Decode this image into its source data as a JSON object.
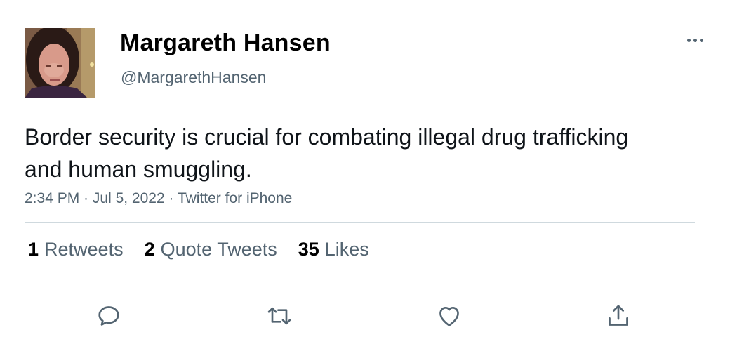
{
  "author": {
    "display_name": "Margareth Hansen",
    "handle": "@MargarethHansen"
  },
  "tweet": {
    "text": "Border security is crucial for combating illegal drug trafficking and human smuggling.",
    "time": "2:34 PM",
    "separator": " · ",
    "date": "Jul 5, 2022",
    "source": "Twitter for iPhone"
  },
  "stats": {
    "retweets_count": "1",
    "retweets_label": "Retweets",
    "quotes_count": "2",
    "quotes_label": "Quote Tweets",
    "likes_count": "35",
    "likes_label": "Likes"
  },
  "icons": {
    "more": "more-horizontal-icon",
    "reply": "reply-icon",
    "retweet": "retweet-icon",
    "like": "heart-icon",
    "share": "share-icon"
  },
  "colors": {
    "text_primary": "#0f1419",
    "text_secondary": "#536471",
    "divider": "#cfd9de",
    "background": "#ffffff"
  }
}
